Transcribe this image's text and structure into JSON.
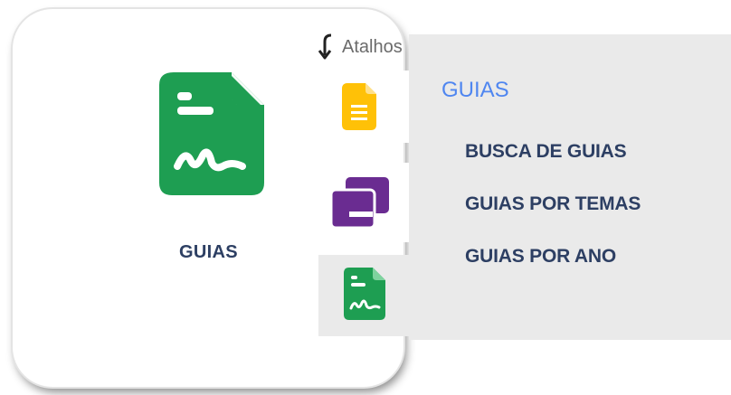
{
  "card": {
    "label": "GUIAS",
    "icon": "guide-document-icon",
    "icon_color": "#1e9e52"
  },
  "shortcuts": {
    "label": "Atalhos",
    "items": [
      {
        "icon": "document-icon",
        "color": "#ffc107"
      },
      {
        "icon": "books-icon",
        "color": "#6a2c91"
      },
      {
        "icon": "guide-document-icon",
        "color": "#1e9e52",
        "active": true
      }
    ]
  },
  "flyout": {
    "title": "GUIAS",
    "title_color": "#4f86f0",
    "items": [
      {
        "label": "BUSCA DE GUIAS"
      },
      {
        "label": "GUIAS POR TEMAS"
      },
      {
        "label": "GUIAS POR ANO"
      }
    ]
  }
}
